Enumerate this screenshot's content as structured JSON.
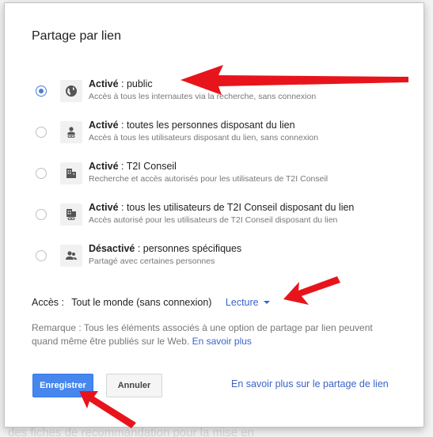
{
  "dialog": {
    "title": "Partage par lien",
    "options": [
      {
        "title_bold": "Activé",
        "title_rest": " : public",
        "desc": "Accès à tous les internautes via la recherche, sans connexion",
        "icon": "globe-icon",
        "checked": true
      },
      {
        "title_bold": "Activé",
        "title_rest": " : toutes les personnes disposant du lien",
        "desc": "Accès à tous les utilisateurs disposant du lien, sans connexion",
        "icon": "person-link-icon",
        "checked": false
      },
      {
        "title_bold": "Activé",
        "title_rest": " : T2I Conseil",
        "desc": "Recherche et accès autorisés pour les utilisateurs de T2I Conseil",
        "icon": "building-icon",
        "checked": false
      },
      {
        "title_bold": "Activé",
        "title_rest": " : tous les utilisateurs de T2I Conseil disposant du lien",
        "desc": "Accès autorisé pour les utilisateurs de T2I Conseil disposant du lien",
        "icon": "building-link-icon",
        "checked": false
      },
      {
        "title_bold": "Désactivé",
        "title_rest": " : personnes spécifiques",
        "desc": "Partagé avec certaines personnes",
        "icon": "people-icon",
        "checked": false
      }
    ],
    "access": {
      "label": "Accès :",
      "value": "Tout le monde (sans connexion)",
      "permission": "Lecture"
    },
    "note": {
      "text": "Remarque : Tous les éléments associés à une option de partage par lien peuvent quand même être publiés sur le Web. ",
      "link": "En savoir plus"
    },
    "buttons": {
      "save": "Enregistrer",
      "cancel": "Annuler"
    },
    "learn_more_link": "En savoir plus sur le partage de lien"
  },
  "background_text": "des fiches de recommandation pour la mise en",
  "colors": {
    "accent": "#4787ed",
    "link": "#3b63c9",
    "annotation_arrow": "#e8141c"
  }
}
